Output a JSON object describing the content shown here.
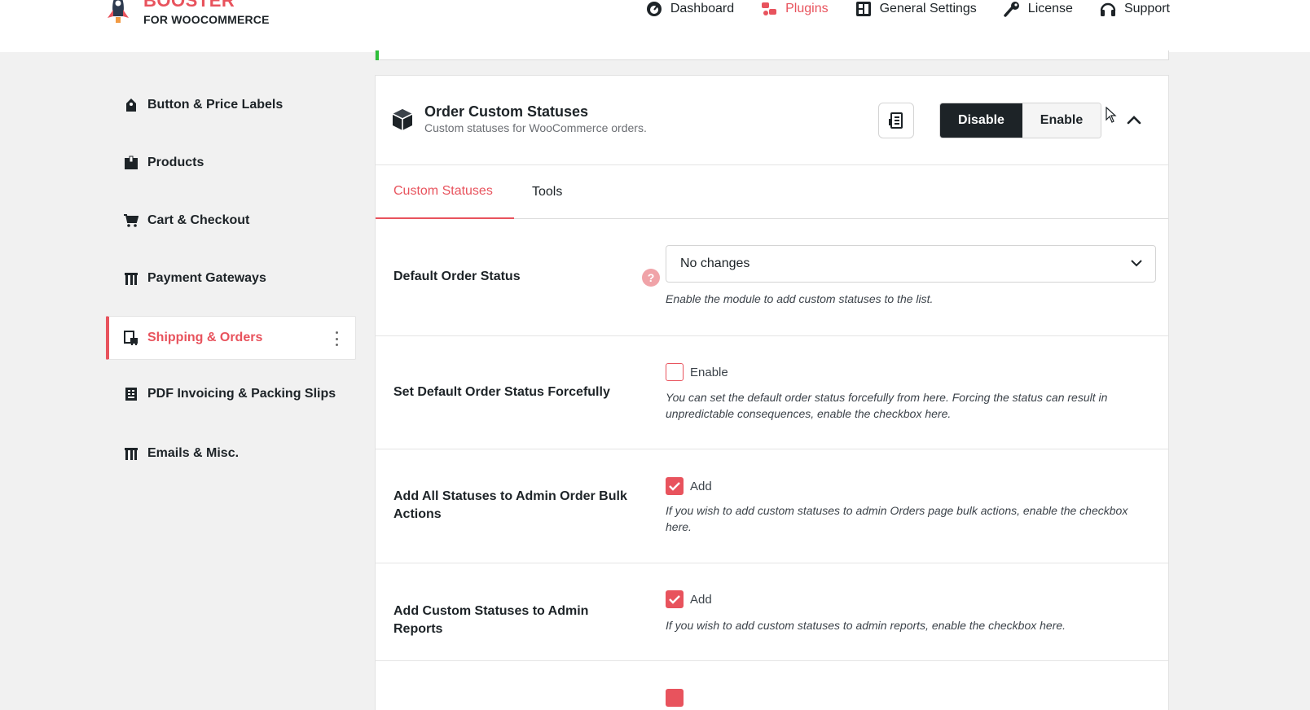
{
  "brand": {
    "name": "BOOSTER",
    "tagline": "FOR WOOCOMMERCE"
  },
  "topnav": [
    {
      "label": "Dashboard",
      "icon": "dashboard-icon"
    },
    {
      "label": "Plugins",
      "icon": "plugins-icon",
      "active": true
    },
    {
      "label": "General Settings",
      "icon": "settings-grid-icon"
    },
    {
      "label": "License",
      "icon": "key-icon"
    },
    {
      "label": "Support",
      "icon": "headset-icon"
    }
  ],
  "sidebar": {
    "items": [
      {
        "label": "Button & Price Labels",
        "icon": "tag-icon"
      },
      {
        "label": "Products",
        "icon": "box-icon"
      },
      {
        "label": "Cart & Checkout",
        "icon": "cart-icon"
      },
      {
        "label": "Payment Gateways",
        "icon": "gateway-icon"
      },
      {
        "label": "Shipping & Orders",
        "icon": "shipping-icon",
        "active": true
      },
      {
        "label": "PDF Invoicing & Packing Slips",
        "icon": "invoice-icon"
      },
      {
        "label": "Emails & Misc.",
        "icon": "misc-icon"
      }
    ]
  },
  "module": {
    "title": "Order Custom Statuses",
    "description": "Custom statuses for WooCommerce orders.",
    "disable_label": "Disable",
    "enable_label": "Enable",
    "state": "disabled"
  },
  "tabs": [
    {
      "label": "Custom Statuses",
      "active": true
    },
    {
      "label": "Tools",
      "active": false
    }
  ],
  "settings": {
    "default_status": {
      "label": "Default Order Status",
      "help": "?",
      "value": "No changes",
      "hint": "Enable the module to add custom statuses to the list."
    },
    "force_default": {
      "label": "Set Default Order Status Forcefully",
      "checkbox_label": "Enable",
      "checked": false,
      "hint": "You can set the default order status forcefully from here. Forcing the status can result in unpredictable consequences, enable the checkbox here."
    },
    "bulk_actions": {
      "label": "Add All Statuses to Admin Order Bulk Actions",
      "checkbox_label": "Add",
      "checked": true,
      "hint": "If you wish to add custom statuses to admin Orders page bulk actions, enable the checkbox here."
    },
    "admin_reports": {
      "label": "Add Custom Statuses to Admin Reports",
      "checkbox_label": "Add",
      "checked": true,
      "hint": "If you wish to add custom statuses to admin reports, enable the checkbox here."
    }
  },
  "colors": {
    "accent": "#e8535d",
    "dark": "#1d2327",
    "success": "#2fbf3b"
  }
}
